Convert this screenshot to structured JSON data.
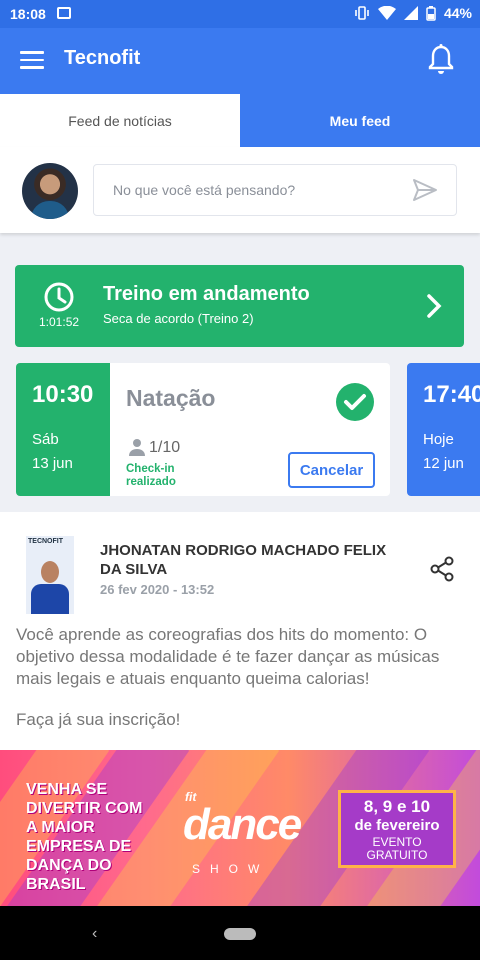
{
  "status": {
    "time": "18:08",
    "battery": "44%"
  },
  "appbar": {
    "title": "Tecnofit"
  },
  "tabs": [
    {
      "label": "Feed de notícias",
      "active": false
    },
    {
      "label": "Meu feed",
      "active": true
    }
  ],
  "composer": {
    "placeholder": "No que você está pensando?"
  },
  "treino": {
    "title": "Treino em andamento",
    "subtitle": "Seca de acordo  (Treino 2)",
    "timer": "1:01:52"
  },
  "classes": [
    {
      "time": "10:30",
      "day": "Sáb",
      "date": "13 jun",
      "name": "Natação",
      "count": "1/10",
      "status": "Check-in realizado",
      "action": "Cancelar"
    },
    {
      "time": "17:40",
      "day": "Hoje",
      "date": "12 jun"
    }
  ],
  "post": {
    "avatar_brand": "TECNOFIT",
    "author": "JHONATAN RODRIGO MACHADO FELIX DA SILVA",
    "date": "26 fev 2020 - 13:52",
    "text": "Você aprende as coreografias dos hits do momento: O objetivo dessa modalidade é te fazer dançar as músicas mais legais e atuais enquanto queima calorias!",
    "cta": "Faça já sua inscrição!"
  },
  "banner": {
    "headline": "VENHA SE DIVERTIR COM A MAIOR EMPRESA DE DANÇA DO BRASIL",
    "brand_small": "fit",
    "brand": "dance",
    "brand_sub": "SHOW",
    "event_dates": "8, 9 e 10",
    "event_month": "de fevereiro",
    "event_note": "EVENTO GRATUITO"
  },
  "colors": {
    "primary": "#3b7af0",
    "success": "#23b26d",
    "muted": "#8a8f98"
  }
}
